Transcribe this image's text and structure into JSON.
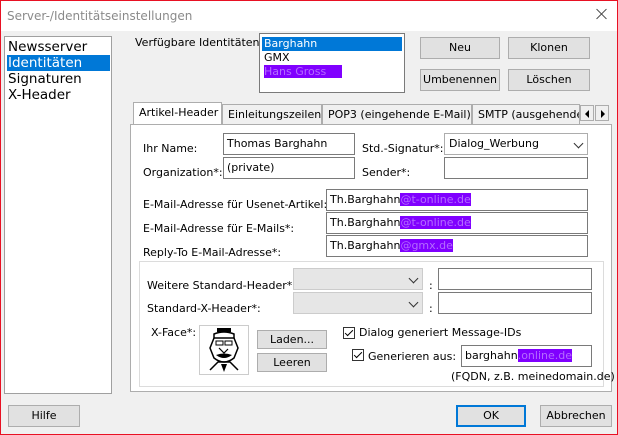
{
  "window": {
    "title": "Server-/Identitätseinstellungen"
  },
  "nav": {
    "items": [
      "Newsserver",
      "Identitäten",
      "Signaturen",
      "X-Header"
    ],
    "selected": 1
  },
  "identities": {
    "label": "Verfügbare Identitäten:",
    "items": [
      "Barghahn",
      "GMX",
      "Hans Gross"
    ]
  },
  "buttons": {
    "new": "Neu",
    "clone": "Klonen",
    "rename": "Umbenennen",
    "delete": "Löschen",
    "load": "Laden...",
    "clear": "Leeren",
    "help": "Hilfe",
    "ok": "OK",
    "cancel": "Abbrechen"
  },
  "tabs": [
    "Artikel-Header",
    "Einleitungszeilen",
    "POP3 (eingehende E-Mail)",
    "SMTP (ausgehende"
  ],
  "form": {
    "name_label": "Ihr Name:",
    "name_value": "Thomas Barghahn",
    "org_label": "Organization*:",
    "org_value": "(private)",
    "sig_label": "Std.-Signatur*:",
    "sig_value": "Dialog_Werbung",
    "sender_label": "Sender*:",
    "sender_value": "",
    "usenet_label": "E-Mail-Adresse für Usenet-Artikel:",
    "usenet_value": "Th.Barghahn",
    "usenet_redacted": "@t-online.de",
    "email_label": "E-Mail-Adresse für E-Mails*:",
    "email_value": "Th.Barghahn",
    "email_redacted": "@t-online.de",
    "replyto_label": "Reply-To E-Mail-Adresse*:",
    "replyto_value": "Th.Barghahn",
    "replyto_redacted": "@gmx.de",
    "more_headers_label": "Weitere Standard-Header*:",
    "xheader_label": "Standard-X-Header*:",
    "colon": ":",
    "xface_label": "X-Face*:",
    "msgid_label": "Dialog generiert Message-IDs",
    "generate_label": "Generieren aus:",
    "generate_value": "barghahn",
    "generate_redacted": ".online.de",
    "fqdn_hint": "(FQDN, z.B. meinedomain.de)"
  },
  "colors": {
    "accent": "#0078d7",
    "redaction": "#8000ff",
    "close_border": "#e81123"
  }
}
